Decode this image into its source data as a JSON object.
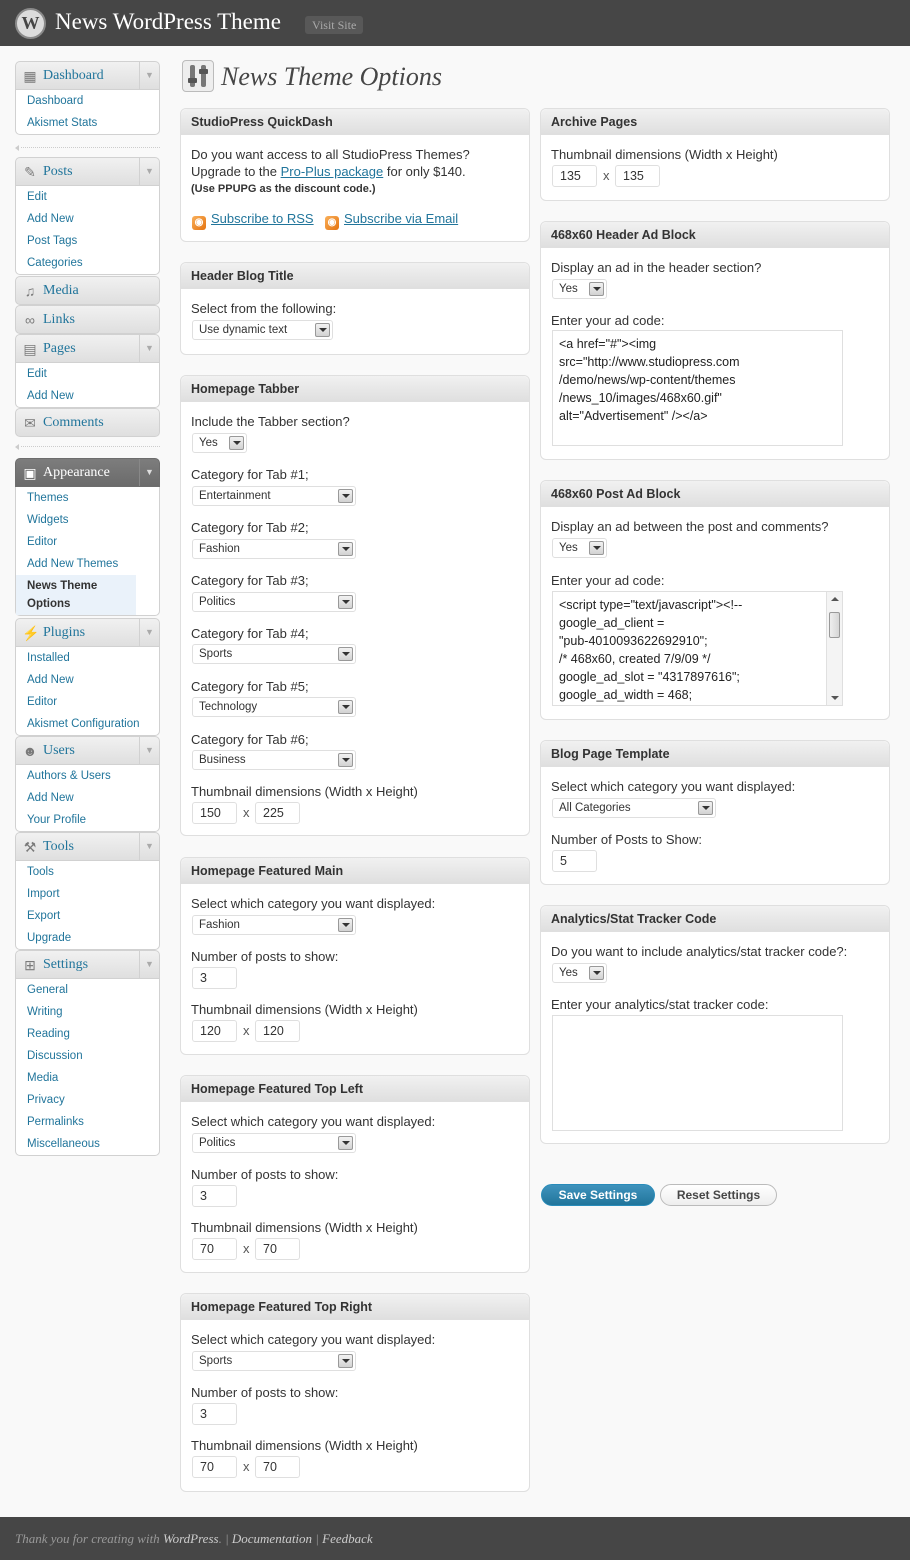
{
  "header": {
    "logo_letter": "W",
    "site_title": "News WordPress Theme",
    "visit_site": "Visit Site"
  },
  "menu": {
    "dashboard": {
      "label": "Dashboard",
      "items": [
        "Dashboard",
        "Akismet Stats"
      ]
    },
    "posts": {
      "label": "Posts",
      "items": [
        "Edit",
        "Add New",
        "Post Tags",
        "Categories"
      ]
    },
    "media": {
      "label": "Media"
    },
    "links": {
      "label": "Links"
    },
    "pages": {
      "label": "Pages",
      "items": [
        "Edit",
        "Add New"
      ]
    },
    "comments": {
      "label": "Comments"
    },
    "appearance": {
      "label": "Appearance",
      "items": [
        "Themes",
        "Widgets",
        "Editor",
        "Add New Themes"
      ],
      "current": "News Theme Options"
    },
    "plugins": {
      "label": "Plugins",
      "items": [
        "Installed",
        "Add New",
        "Editor",
        "Akismet Configuration"
      ]
    },
    "users": {
      "label": "Users",
      "items": [
        "Authors & Users",
        "Add New",
        "Your Profile"
      ]
    },
    "tools": {
      "label": "Tools",
      "items": [
        "Tools",
        "Import",
        "Export",
        "Upgrade"
      ]
    },
    "settings": {
      "label": "Settings",
      "items": [
        "General",
        "Writing",
        "Reading",
        "Discussion",
        "Media",
        "Privacy",
        "Permalinks",
        "Miscellaneous"
      ]
    }
  },
  "page_title": "News Theme Options",
  "quickdash": {
    "title": "StudioPress QuickDash",
    "line1": "Do you want access to all StudioPress Themes?",
    "line2_pre": "Upgrade to the ",
    "line2_link": "Pro-Plus package",
    "line2_post": " for only $140.",
    "note": "(Use PPUPG as the discount code.)",
    "rss": "Subscribe to RSS",
    "email": "Subscribe via Email"
  },
  "header_blog_title": {
    "title": "Header Blog Title",
    "label": "Select from the following:",
    "value": "Use dynamic text"
  },
  "tabber": {
    "title": "Homepage Tabber",
    "include_label": "Include the Tabber section?",
    "include_value": "Yes",
    "tabs": [
      {
        "label": "Category for Tab #1;",
        "value": "Entertainment"
      },
      {
        "label": "Category for Tab #2;",
        "value": "Fashion"
      },
      {
        "label": "Category for Tab #3;",
        "value": "Politics"
      },
      {
        "label": "Category for Tab #4;",
        "value": "Sports"
      },
      {
        "label": "Category for Tab #5;",
        "value": "Technology"
      },
      {
        "label": "Category for Tab #6;",
        "value": "Business"
      }
    ],
    "thumb_label": "Thumbnail dimensions (Width x Height)",
    "thumb_w": "150",
    "thumb_h": "225",
    "times": "x"
  },
  "featured_main": {
    "title": "Homepage Featured Main",
    "cat_label": "Select which category you want displayed:",
    "cat_value": "Fashion",
    "posts_label": "Number of posts to show:",
    "posts_value": "3",
    "thumb_label": "Thumbnail dimensions (Width x Height)",
    "thumb_w": "120",
    "thumb_h": "120"
  },
  "featured_top_left": {
    "title": "Homepage Featured Top Left",
    "cat_label": "Select which category you want displayed:",
    "cat_value": "Politics",
    "posts_label": "Number of posts to show:",
    "posts_value": "3",
    "thumb_label": "Thumbnail dimensions (Width x Height)",
    "thumb_w": "70",
    "thumb_h": "70"
  },
  "featured_top_right": {
    "title": "Homepage Featured Top Right",
    "cat_label": "Select which category you want displayed:",
    "cat_value": "Sports",
    "posts_label": "Number of posts to show:",
    "posts_value": "3",
    "thumb_label": "Thumbnail dimensions (Width x Height)",
    "thumb_w": "70",
    "thumb_h": "70"
  },
  "archive": {
    "title": "Archive Pages",
    "thumb_label": "Thumbnail dimensions (Width x Height)",
    "thumb_w": "135",
    "thumb_h": "135"
  },
  "header_ad": {
    "title": "468x60 Header Ad Block",
    "display_label": "Display an ad in the header section?",
    "display_value": "Yes",
    "code_label": "Enter your ad code:",
    "code": "<a href=\"#\"><img\nsrc=\"http://www.studiopress.com\n/demo/news/wp-content/themes\n/news_10/images/468x60.gif\"\nalt=\"Advertisement\" /></a>"
  },
  "post_ad": {
    "title": "468x60 Post Ad Block",
    "display_label": "Display an ad between the post and comments?",
    "display_value": "Yes",
    "code_label": "Enter your ad code:",
    "code": "<script type=\"text/javascript\"><!--\ngoogle_ad_client =\n\"pub-4010093622692910\";\n/* 468x60, created 7/9/09 */\ngoogle_ad_slot = \"4317897616\";\ngoogle_ad_width = 468;"
  },
  "blog_template": {
    "title": "Blog Page Template",
    "cat_label": "Select which category you want displayed:",
    "cat_value": "All Categories",
    "posts_label": "Number of Posts to Show:",
    "posts_value": "5"
  },
  "analytics": {
    "title": "Analytics/Stat Tracker Code",
    "include_label": "Do you want to include analytics/stat tracker code?:",
    "include_value": "Yes",
    "code_label": "Enter your analytics/stat tracker code:",
    "code": ""
  },
  "buttons": {
    "save": "Save Settings",
    "reset": "Reset Settings"
  },
  "footer": {
    "thanks_pre": "Thank you for creating with ",
    "wordpress": "WordPress",
    "dot": ".",
    "sep": "|",
    "documentation": "Documentation",
    "feedback": "Feedback"
  }
}
